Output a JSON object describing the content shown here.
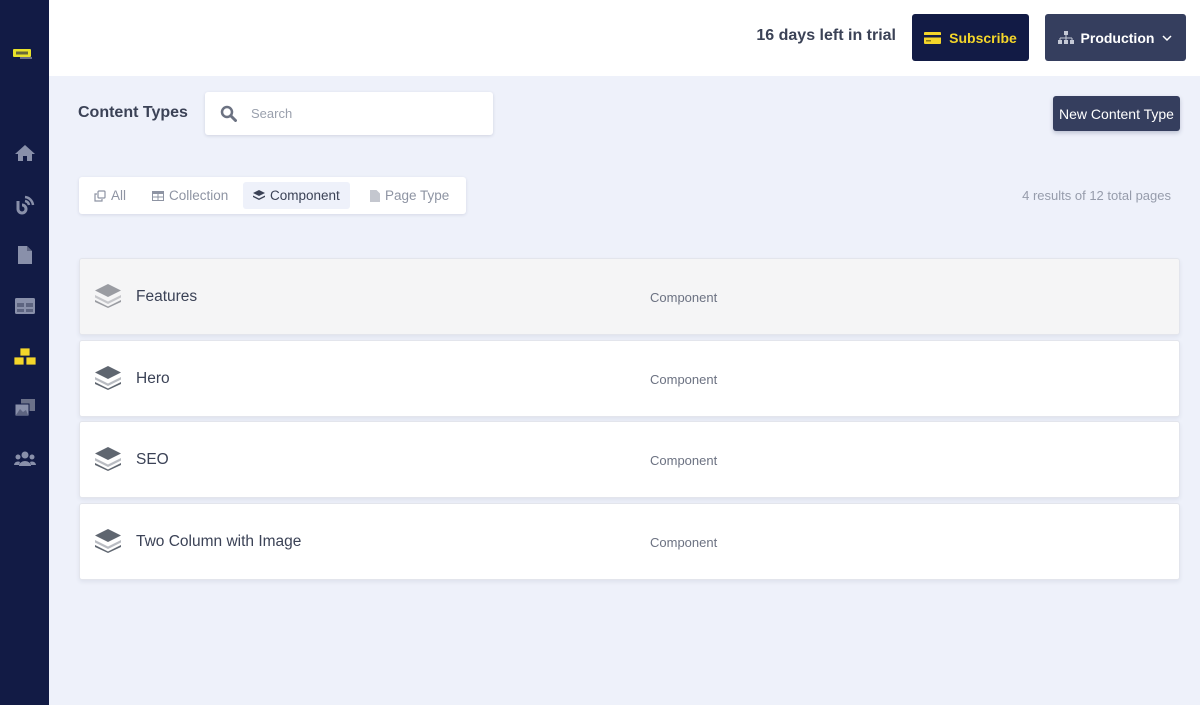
{
  "sidebar": {
    "logo": "app-logo",
    "items": [
      {
        "name": "home",
        "icon": "home-icon",
        "active": false
      },
      {
        "name": "feeds",
        "icon": "rss-icon",
        "active": false
      },
      {
        "name": "pages",
        "icon": "file-icon",
        "active": false
      },
      {
        "name": "collections",
        "icon": "table-icon",
        "active": false
      },
      {
        "name": "content-types",
        "icon": "boxes-icon",
        "active": true
      },
      {
        "name": "media",
        "icon": "images-icon",
        "active": false
      },
      {
        "name": "users",
        "icon": "users-icon",
        "active": false
      }
    ]
  },
  "header": {
    "trial_text": "16 days left in trial",
    "subscribe_label": "Subscribe",
    "environment_label": "Production"
  },
  "toolbar": {
    "title": "Content Types",
    "search_placeholder": "Search",
    "search_value": "",
    "new_button_label": "New Content Type"
  },
  "filters": {
    "tabs": [
      {
        "label": "All",
        "icon": "copy-icon",
        "active": false
      },
      {
        "label": "Collection",
        "icon": "table-icon",
        "active": false
      },
      {
        "label": "Component",
        "icon": "layers-icon",
        "active": true
      },
      {
        "label": "Page Type",
        "icon": "file-icon",
        "active": false
      }
    ],
    "results_text": "4 results of 12 total pages"
  },
  "content_types": [
    {
      "name": "Features",
      "type": "Component"
    },
    {
      "name": "Hero",
      "type": "Component"
    },
    {
      "name": "SEO",
      "type": "Component"
    },
    {
      "name": "Two Column with Image",
      "type": "Component"
    }
  ],
  "colors": {
    "sidebar_bg": "#121b45",
    "accent_yellow": "#f4d62a",
    "primary_button": "#353e5e",
    "page_bg": "#eef1fa"
  }
}
